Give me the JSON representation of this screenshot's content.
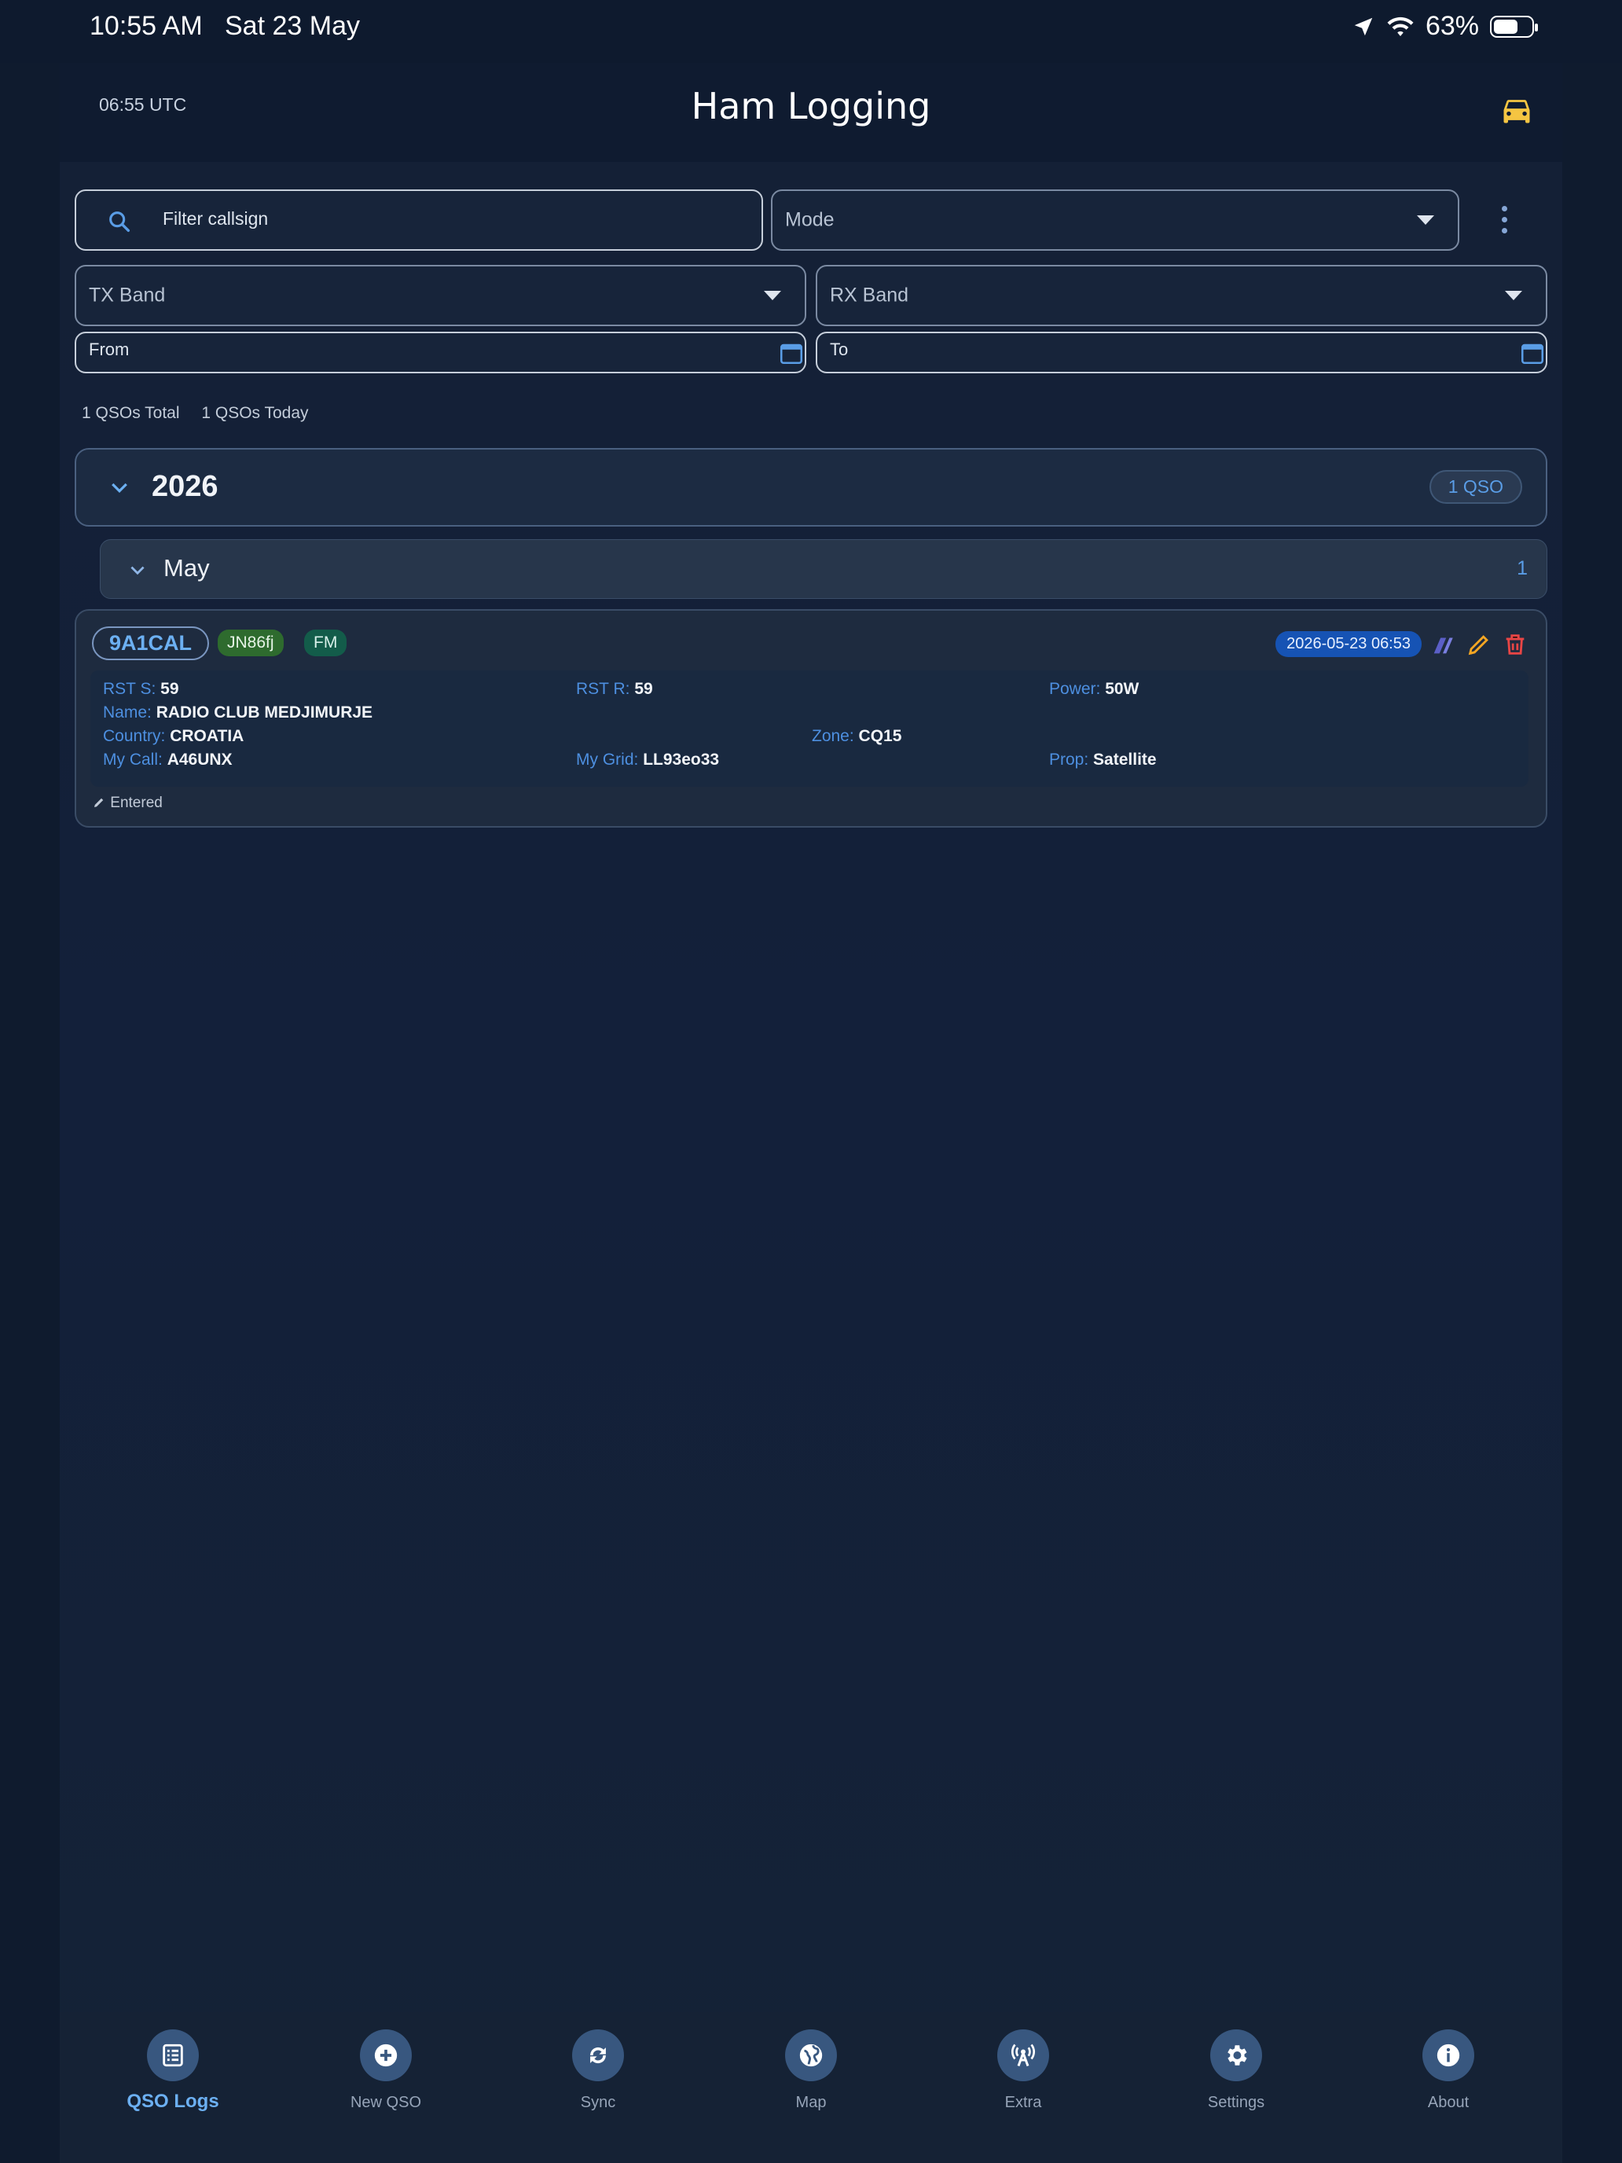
{
  "status_bar": {
    "time": "10:55 AM",
    "date": "Sat 23 May",
    "battery": "63%",
    "battery_level": 0.63
  },
  "header": {
    "utc": "06:55 UTC",
    "title": "Ham Logging",
    "car_icon": "car-icon",
    "accent": "#f5c542"
  },
  "filters": {
    "callsign_placeholder": "Filter callsign",
    "mode": "Mode",
    "tx_band": "TX Band",
    "rx_band": "RX Band",
    "from": "From",
    "to": "To"
  },
  "summary": {
    "total": "1 QSOs Total",
    "today": "1 QSOs Today"
  },
  "groups": {
    "year": {
      "label": "2026",
      "badge": "1 QSO"
    },
    "month": {
      "label": "May",
      "count": "1"
    }
  },
  "qso": {
    "callsign": "9A1CAL",
    "grid": "JN86fj",
    "mode": "FM",
    "datetime": "2026-05-23 06:53",
    "rst_s_label": "RST S:",
    "rst_s": "59",
    "rst_r_label": "RST R:",
    "rst_r": "59",
    "power_label": "Power:",
    "power": "50W",
    "name_label": "Name:",
    "name": "RADIO CLUB MEDJIMURJE",
    "country_label": "Country:",
    "country": "CROATIA",
    "zone_label": "Zone:",
    "zone": "CQ15",
    "my_call_label": "My Call:",
    "my_call": "A46UNX",
    "my_grid_label": "My Grid:",
    "my_grid": "LL93eo33",
    "prop_label": "Prop:",
    "prop": "Satellite",
    "entered": "Entered"
  },
  "tabs": [
    {
      "label": "QSO Logs",
      "icon": "list-icon",
      "active": true
    },
    {
      "label": "New QSO",
      "icon": "plus-circle-icon"
    },
    {
      "label": "Sync",
      "icon": "sync-icon"
    },
    {
      "label": "Map",
      "icon": "globe-icon"
    },
    {
      "label": "Extra",
      "icon": "antenna-icon"
    },
    {
      "label": "Settings",
      "icon": "gear-icon"
    },
    {
      "label": "About",
      "icon": "info-icon"
    }
  ]
}
